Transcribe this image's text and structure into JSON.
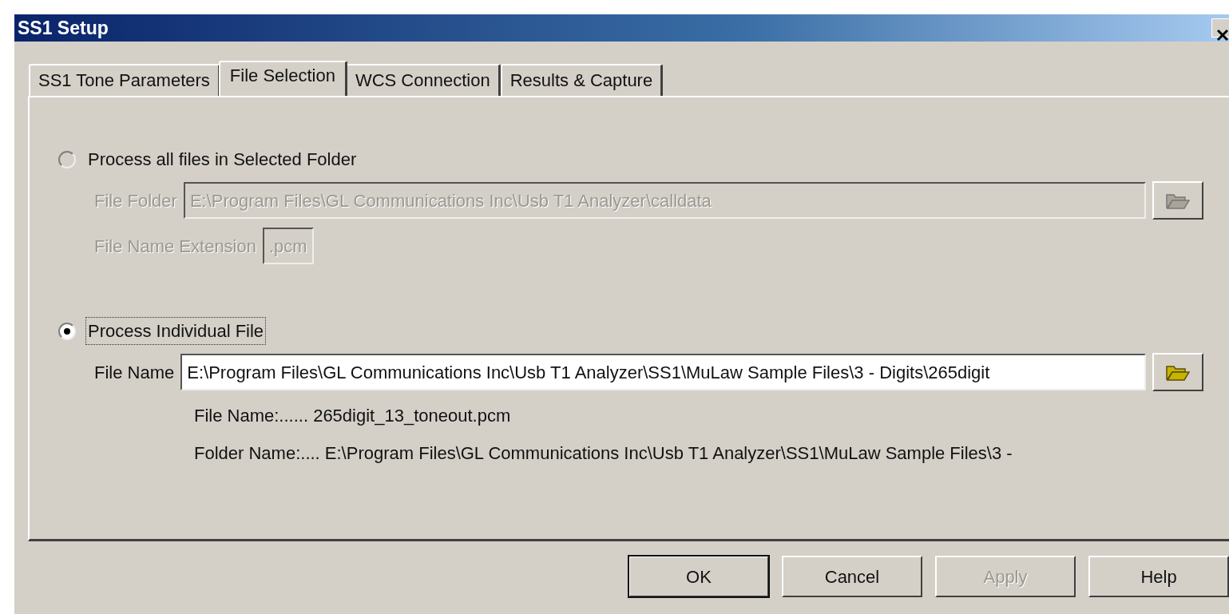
{
  "window": {
    "title": "SS1 Setup"
  },
  "tabs": [
    {
      "label": "SS1 Tone Parameters",
      "selected": false
    },
    {
      "label": "File Selection",
      "selected": true
    },
    {
      "label": "WCS Connection",
      "selected": false
    },
    {
      "label": "Results & Capture",
      "selected": false
    }
  ],
  "groups": [
    {
      "radio": {
        "label": "Process all files in Selected Folder",
        "selected": false,
        "focused": false
      },
      "disabled": true,
      "fields": [
        {
          "label": "File Folder",
          "value": "E:\\Program Files\\GL Communications Inc\\Usb T1 Analyzer\\calldata",
          "browse": true
        },
        {
          "label": "File Name Extension",
          "value": ".pcm",
          "browse": false
        }
      ]
    },
    {
      "radio": {
        "label": "Process Individual File",
        "selected": true,
        "focused": true
      },
      "disabled": false,
      "fields": [
        {
          "label": "File Name",
          "value": "E:\\Program Files\\GL Communications Inc\\Usb T1 Analyzer\\SS1\\MuLaw Sample Files\\3 - Digits\\265digit",
          "browse": true
        }
      ],
      "info": [
        "File Name:...... 265digit_13_toneout.pcm",
        "Folder Name:.... E:\\Program Files\\GL Communications Inc\\Usb T1 Analyzer\\SS1\\MuLaw Sample Files\\3 -"
      ]
    }
  ],
  "buttons": [
    {
      "label": "OK",
      "default": true,
      "disabled": false
    },
    {
      "label": "Cancel",
      "default": false,
      "disabled": false
    },
    {
      "label": "Apply",
      "default": false,
      "disabled": true
    },
    {
      "label": "Help",
      "default": false,
      "disabled": false
    }
  ]
}
